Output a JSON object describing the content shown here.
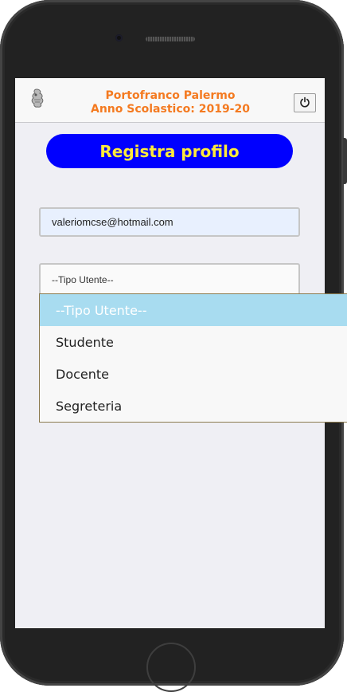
{
  "header": {
    "title_line1": "Portofranco Palermo",
    "title_line2": "Anno Scolastico: 2019-20",
    "logo_icon": "portofranco-logo-icon",
    "power_icon": "power-icon"
  },
  "main": {
    "register_button_label": "Registra profilo",
    "email_value": "valeriomcse@hotmail.com",
    "user_type_select": {
      "selected": "--Tipo Utente--",
      "options": [
        "--Tipo Utente--",
        "Studente",
        "Docente",
        "Segreteria"
      ]
    }
  },
  "colors": {
    "header_title": "#f47a20",
    "register_button_bg": "#0000ff",
    "register_button_text": "#ffeb3b",
    "option_highlight": "#a8dcf0",
    "email_input_bg": "#e8f0fe"
  }
}
